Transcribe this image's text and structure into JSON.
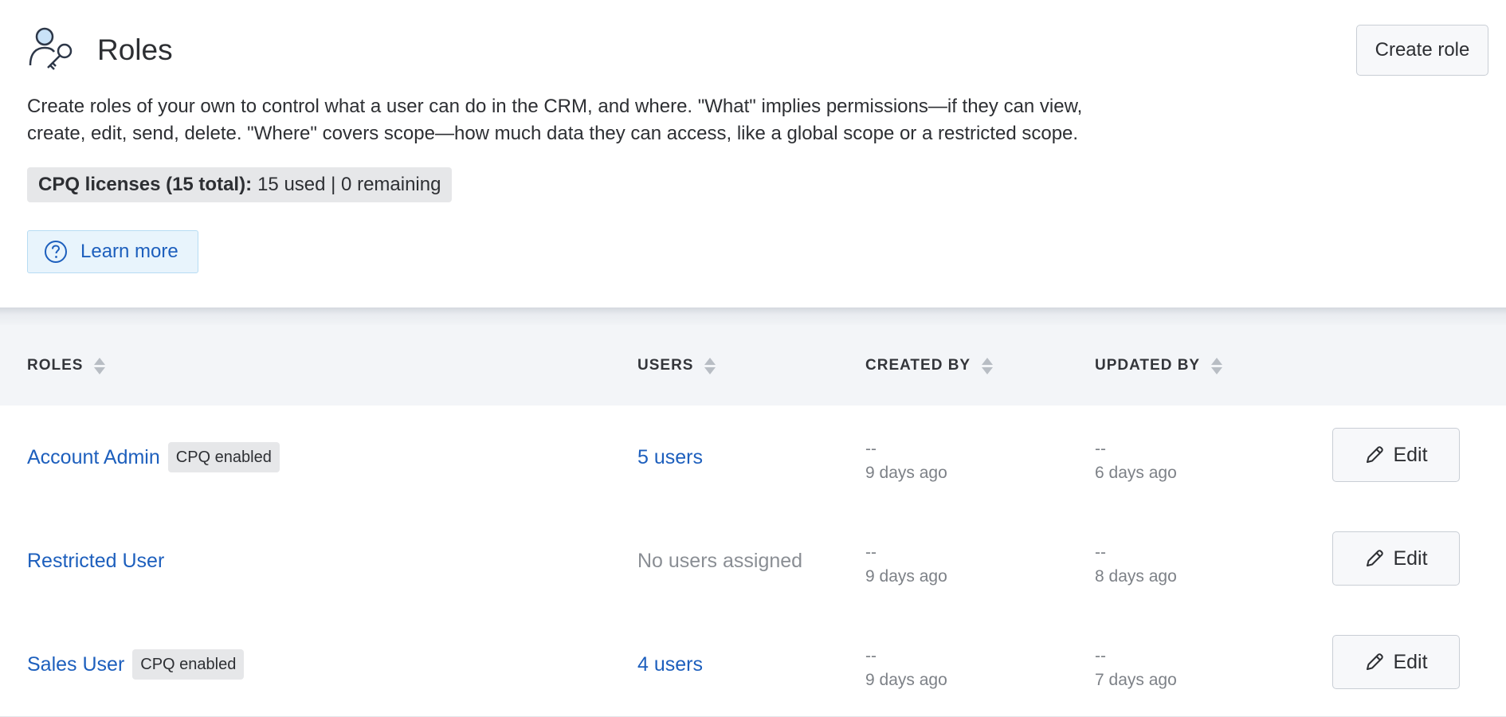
{
  "page": {
    "title": "Roles",
    "create_button": "Create role",
    "description_line1": "Create roles of your own to control what a user can do in the CRM, and where. \"What\" implies permissions—if they can view,",
    "description_line2": "create, edit, send, delete. \"Where\" covers scope—how much data they can access, like a global scope or a restricted scope.",
    "license_label": "CPQ licenses (15 total):",
    "license_value": "15 used | 0 remaining",
    "learn_more": "Learn more",
    "icons": {
      "header": "user-key-icon",
      "learn_more": "question-circle-icon",
      "edit": "pencil-icon",
      "sort": "sort-icon"
    },
    "colors": {
      "link": "#1d5fbd",
      "header_bg": "#f3f5f8",
      "badge_bg": "#e6e7e9"
    }
  },
  "table": {
    "columns": {
      "roles": "ROLES",
      "users": "USERS",
      "created_by": "CREATED BY",
      "updated_by": "UPDATED BY"
    },
    "rows": [
      {
        "role": "Account Admin",
        "badge": "CPQ enabled",
        "users": "5 users",
        "users_assigned": true,
        "created_by": "--",
        "created_when": "9 days ago",
        "updated_by": "--",
        "updated_when": "6 days ago",
        "action": "Edit"
      },
      {
        "role": "Restricted User",
        "badge": "",
        "users": "No users assigned",
        "users_assigned": false,
        "created_by": "--",
        "created_when": "9 days ago",
        "updated_by": "--",
        "updated_when": "8 days ago",
        "action": "Edit"
      },
      {
        "role": "Sales User",
        "badge": "CPQ enabled",
        "users": "4 users",
        "users_assigned": true,
        "created_by": "--",
        "created_when": "9 days ago",
        "updated_by": "--",
        "updated_when": "7 days ago",
        "action": "Edit"
      }
    ]
  }
}
